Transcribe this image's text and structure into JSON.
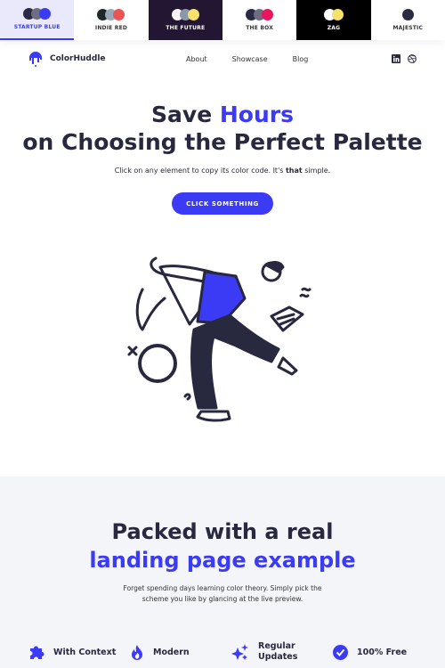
{
  "palettes": [
    {
      "label": "STARTUP BLUE",
      "colors": [
        "#2a2a45",
        "#6e6e80",
        "#3b3bf5"
      ],
      "bg": "#e9e9fb",
      "fg": "#3b3bf5"
    },
    {
      "label": "INDIE RED",
      "colors": [
        "#1e2a2a",
        "#9aa8b8",
        "#ea5455"
      ],
      "bg": "#ffffff",
      "fg": "#333333"
    },
    {
      "label": "THE FUTURE",
      "colors": [
        "#f7f3f7",
        "#8a98a8",
        "#f6e26b"
      ],
      "bg": "#221633",
      "fg": "#ffffff"
    },
    {
      "label": "THE BOX",
      "colors": [
        "#2a2a45",
        "#6e6e80",
        "#e8175d"
      ],
      "bg": "#ffffff",
      "fg": "#333333"
    },
    {
      "label": "ZAG",
      "colors": [
        "#ffffff",
        "#f6e26b"
      ],
      "bg": "#000000",
      "fg": "#ffffff"
    },
    {
      "label": "MAJESTIC",
      "colors": [
        "#2a2a45"
      ],
      "bg": "#ffffff",
      "fg": "#333333"
    }
  ],
  "nav": {
    "brand": "ColorHuddle",
    "links": [
      "About",
      "Showcase",
      "Blog"
    ]
  },
  "hero": {
    "title_pre": "Save ",
    "title_accent": "Hours",
    "title_post": " on Choosing the Perfect Palette",
    "sub_pre": "Click on any element to copy its color code. It's ",
    "sub_bold": "that",
    "sub_post": " simple.",
    "cta": "CLICK SOMETHING"
  },
  "section2": {
    "title_line1": "Packed with a real",
    "title_line2": "landing page example",
    "desc_line1": "Forget spending days learning color theory. Simply pick the",
    "desc_line2": "scheme you like by glancing at the live preview."
  },
  "features": [
    {
      "icon": "puzzle-icon",
      "label": "With Context"
    },
    {
      "icon": "flame-icon",
      "label": "Modern"
    },
    {
      "icon": "sparkles-icon",
      "label": "Regular Updates"
    },
    {
      "icon": "check-circle-icon",
      "label": "100% Free"
    }
  ],
  "colors": {
    "accent": "#3b3bf5",
    "dark": "#28283f"
  }
}
